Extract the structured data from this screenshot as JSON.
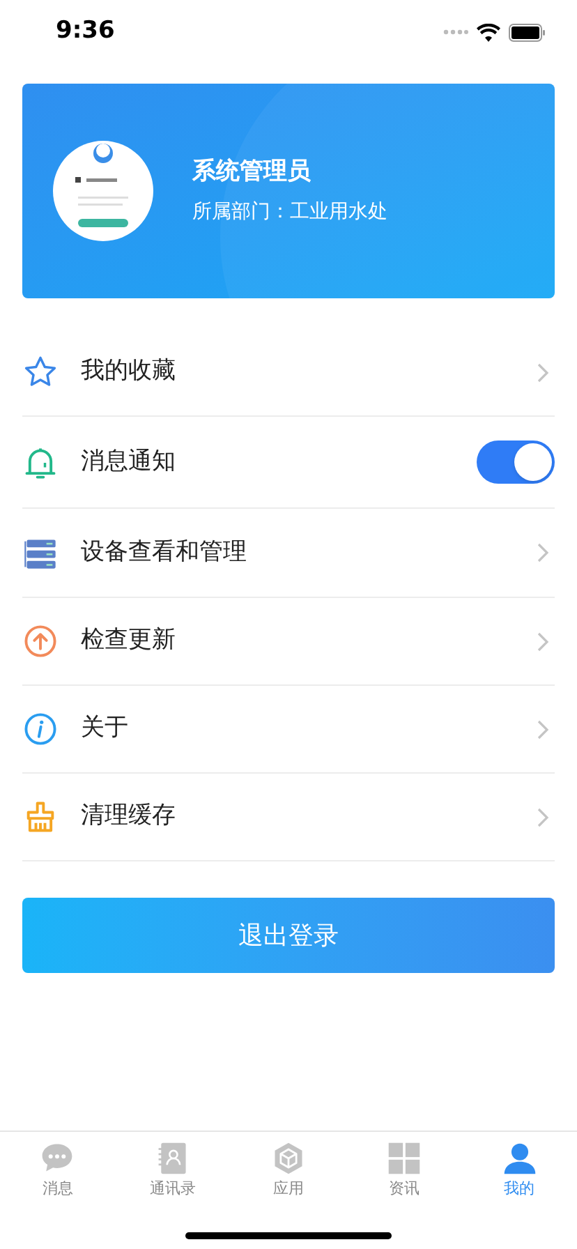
{
  "status_bar": {
    "time": "9:36"
  },
  "profile": {
    "name": "系统管理员",
    "department": "所属部门：工业用水处"
  },
  "menu": [
    {
      "kind": "link",
      "label": "我的收藏"
    },
    {
      "kind": "toggle",
      "label": "消息通知",
      "on": true
    },
    {
      "kind": "link",
      "label": "设备查看和管理"
    },
    {
      "kind": "link",
      "label": "检查更新"
    },
    {
      "kind": "link",
      "label": "关于"
    },
    {
      "kind": "link",
      "label": "清理缓存"
    }
  ],
  "logout_button": "退出登录",
  "tabs": [
    {
      "label": "消息",
      "selected": false
    },
    {
      "label": "通讯录",
      "selected": false
    },
    {
      "label": "应用",
      "selected": false
    },
    {
      "label": "资讯",
      "selected": false
    },
    {
      "label": "我的",
      "selected": true
    }
  ]
}
